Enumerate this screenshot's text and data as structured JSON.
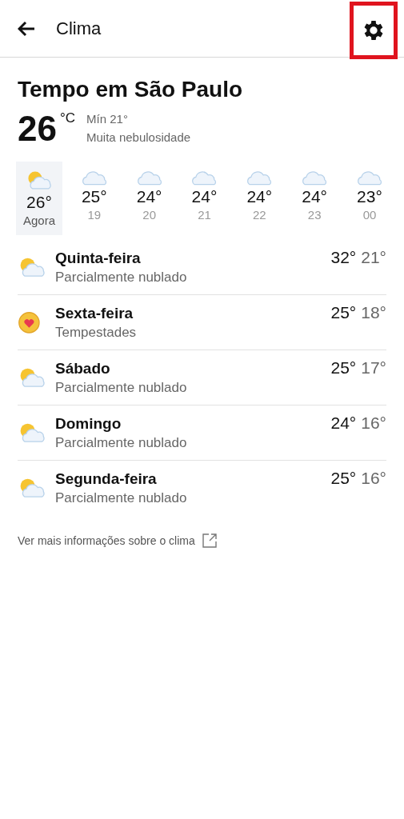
{
  "header": {
    "title": "Clima",
    "settings_highlighted": true
  },
  "location_title": "Tempo em São Paulo",
  "current": {
    "temp": "26",
    "unit": "°C",
    "min": "Mín 21°",
    "condition": "Muita nebulosidade"
  },
  "hourly": [
    {
      "kind": "partly_cloudy",
      "temp": "26°",
      "time": "Agora",
      "selected": true
    },
    {
      "kind": "cloudy",
      "temp": "25°",
      "time": "19",
      "selected": false
    },
    {
      "kind": "cloudy",
      "temp": "24°",
      "time": "20",
      "selected": false
    },
    {
      "kind": "cloudy",
      "temp": "24°",
      "time": "21",
      "selected": false
    },
    {
      "kind": "cloudy",
      "temp": "24°",
      "time": "22",
      "selected": false
    },
    {
      "kind": "cloudy",
      "temp": "24°",
      "time": "23",
      "selected": false
    },
    {
      "kind": "cloudy",
      "temp": "23°",
      "time": "00",
      "selected": false
    }
  ],
  "daily": [
    {
      "kind": "partly_cloudy",
      "day": "Quinta-feira",
      "condition": "Parcialmente nublado",
      "high": "32°",
      "low": "21°"
    },
    {
      "kind": "heart",
      "day": "Sexta-feira",
      "condition": "Tempestades",
      "high": "25°",
      "low": "18°"
    },
    {
      "kind": "partly_cloudy",
      "day": "Sábado",
      "condition": "Parcialmente nublado",
      "high": "25°",
      "low": "17°"
    },
    {
      "kind": "partly_cloudy",
      "day": "Domingo",
      "condition": "Parcialmente nublado",
      "high": "24°",
      "low": "16°"
    },
    {
      "kind": "partly_cloudy",
      "day": "Segunda-feira",
      "condition": "Parcialmente nublado",
      "high": "25°",
      "low": "16°"
    }
  ],
  "more_link": "Ver mais informações sobre o clima"
}
